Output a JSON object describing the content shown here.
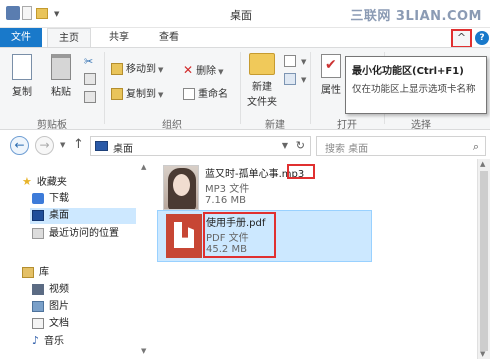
{
  "window": {
    "title": "桌面",
    "watermark": "三联网 3LIAN.COM"
  },
  "ribbon_tabs": [
    {
      "label": "文件"
    },
    {
      "label": "主页"
    },
    {
      "label": "共享"
    },
    {
      "label": "查看"
    }
  ],
  "ribbon_controls": {
    "minimize_glyph": "^",
    "help_glyph": "?"
  },
  "ribbon": {
    "clipboard": {
      "copy": "复制",
      "paste": "粘贴",
      "label": "剪贴板"
    },
    "organize": {
      "move_to": "移动到",
      "copy_to": "复制到",
      "delete": "删除",
      "rename": "重命名",
      "label": "组织"
    },
    "new": {
      "new_folder_line1": "新建",
      "new_folder_line2": "文件夹",
      "label": "新建"
    },
    "open": {
      "properties": "属性",
      "label": "打开"
    },
    "select": {
      "label": "选择"
    }
  },
  "tooltip": {
    "title": "最小化功能区(Ctrl+F1)",
    "body": "仅在功能区上显示选项卡名称"
  },
  "address": {
    "path": "桌面",
    "search_placeholder": "搜索 桌面"
  },
  "nav_pane": {
    "favorites": "收藏夹",
    "download": "下载",
    "desktop": "桌面",
    "recent": "最近访问的位置",
    "libraries": "库",
    "videos": "视频",
    "pictures": "图片",
    "documents": "文档",
    "music": "音乐"
  },
  "files": [
    {
      "name": "蓝又时-孤单心事.mp3",
      "type": "MP3 文件",
      "size": "7.16 MB"
    },
    {
      "name": "使用手册.pdf",
      "type": "PDF 文件",
      "size": "45.2 MB"
    }
  ]
}
